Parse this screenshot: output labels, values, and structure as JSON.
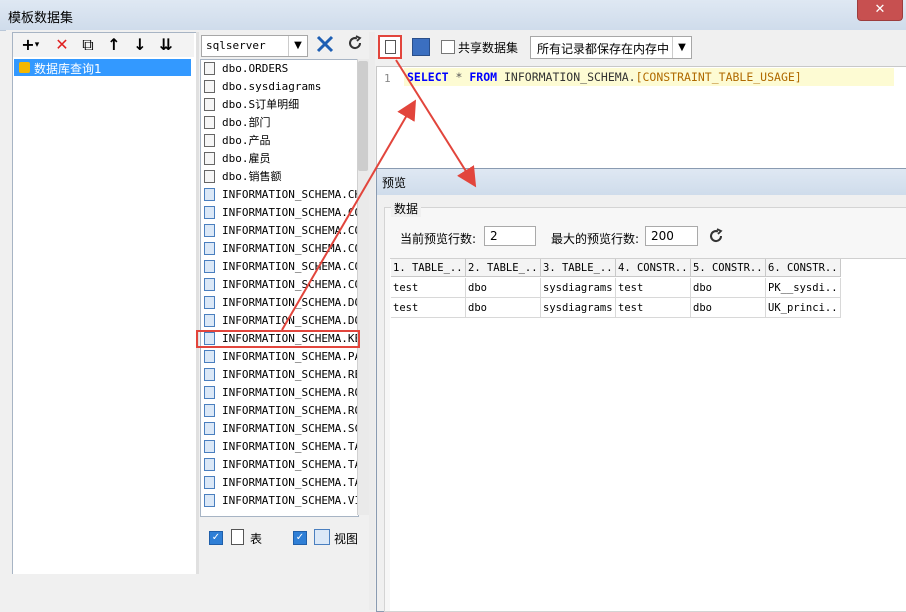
{
  "window": {
    "title": "模板数据集",
    "close": "✕"
  },
  "left_toolbar": {
    "add": "+",
    "add_arrow": "▾",
    "delete": "✕",
    "copy": "⧉",
    "up": "↑",
    "down": "↓",
    "sort": "⇊"
  },
  "tree": {
    "items": [
      {
        "label": "数据库查询1"
      }
    ]
  },
  "middle": {
    "datasource": "sqlserver",
    "tables": [
      {
        "name": "dbo.ORDERS",
        "type": "table"
      },
      {
        "name": "dbo.sysdiagrams",
        "type": "table"
      },
      {
        "name": "dbo.S订单明细",
        "type": "table"
      },
      {
        "name": "dbo.部门",
        "type": "table"
      },
      {
        "name": "dbo.产品",
        "type": "table"
      },
      {
        "name": "dbo.雇员",
        "type": "table"
      },
      {
        "name": "dbo.销售额",
        "type": "table"
      },
      {
        "name": "INFORMATION_SCHEMA.CHECK",
        "type": "view"
      },
      {
        "name": "INFORMATION_SCHEMA.COLU",
        "type": "view"
      },
      {
        "name": "INFORMATION_SCHEMA.COLU",
        "type": "view"
      },
      {
        "name": "INFORMATION_SCHEMA.COLU",
        "type": "view"
      },
      {
        "name": "INFORMATION_SCHEMA.CONS",
        "type": "view"
      },
      {
        "name": "INFORMATION_SCHEMA.CONS",
        "type": "view"
      },
      {
        "name": "INFORMATION_SCHEMA.DOMA",
        "type": "view"
      },
      {
        "name": "INFORMATION_SCHEMA.DOMA",
        "type": "view"
      },
      {
        "name": "INFORMATION_SCHEMA.KEY_",
        "type": "view"
      },
      {
        "name": "INFORMATION_SCHEMA.PARA",
        "type": "view"
      },
      {
        "name": "INFORMATION_SCHEMA.REFE",
        "type": "view"
      },
      {
        "name": "INFORMATION_SCHEMA.ROUT",
        "type": "view"
      },
      {
        "name": "INFORMATION_SCHEMA.ROUT",
        "type": "view"
      },
      {
        "name": "INFORMATION_SCHEMA.SCHE",
        "type": "view"
      },
      {
        "name": "INFORMATION_SCHEMA.TABL",
        "type": "view"
      },
      {
        "name": "INFORMATION_SCHEMA.TABL",
        "type": "view"
      },
      {
        "name": "INFORMATION_SCHEMA.TABL",
        "type": "view"
      },
      {
        "name": "INFORMATION_SCHEMA.VIEW",
        "type": "view"
      }
    ],
    "filter_table_label": "表",
    "filter_view_label": "视图"
  },
  "editor": {
    "share_label": "共享数据集",
    "mode": "所有记录都保存在内存中",
    "line_number": "1",
    "sql_kw1": "SELECT",
    "sql_star": "*",
    "sql_kw2": "FROM",
    "sql_schema": "INFORMATION_SCHEMA.",
    "sql_table": "[CONSTRAINT_TABLE_USAGE]"
  },
  "preview": {
    "title": "预览",
    "group_label": "数据",
    "current_rows_label": "当前预览行数:",
    "current_rows": "2",
    "max_rows_label": "最大的预览行数:",
    "max_rows": "200",
    "columns": [
      "1. TABLE_...",
      "2. TABLE_...",
      "3. TABLE_...",
      "4. CONSTR...",
      "5. CONSTR...",
      "6. CONSTR..."
    ],
    "rows": [
      [
        "test",
        "dbo",
        "sysdiagrams",
        "test",
        "dbo",
        "PK__sysdi..."
      ],
      [
        "test",
        "dbo",
        "sysdiagrams",
        "test",
        "dbo",
        "UK_princi..."
      ]
    ]
  },
  "colors": {
    "accent": "#3399ff",
    "highlight": "#e2453c",
    "keyword": "#0000ff"
  }
}
